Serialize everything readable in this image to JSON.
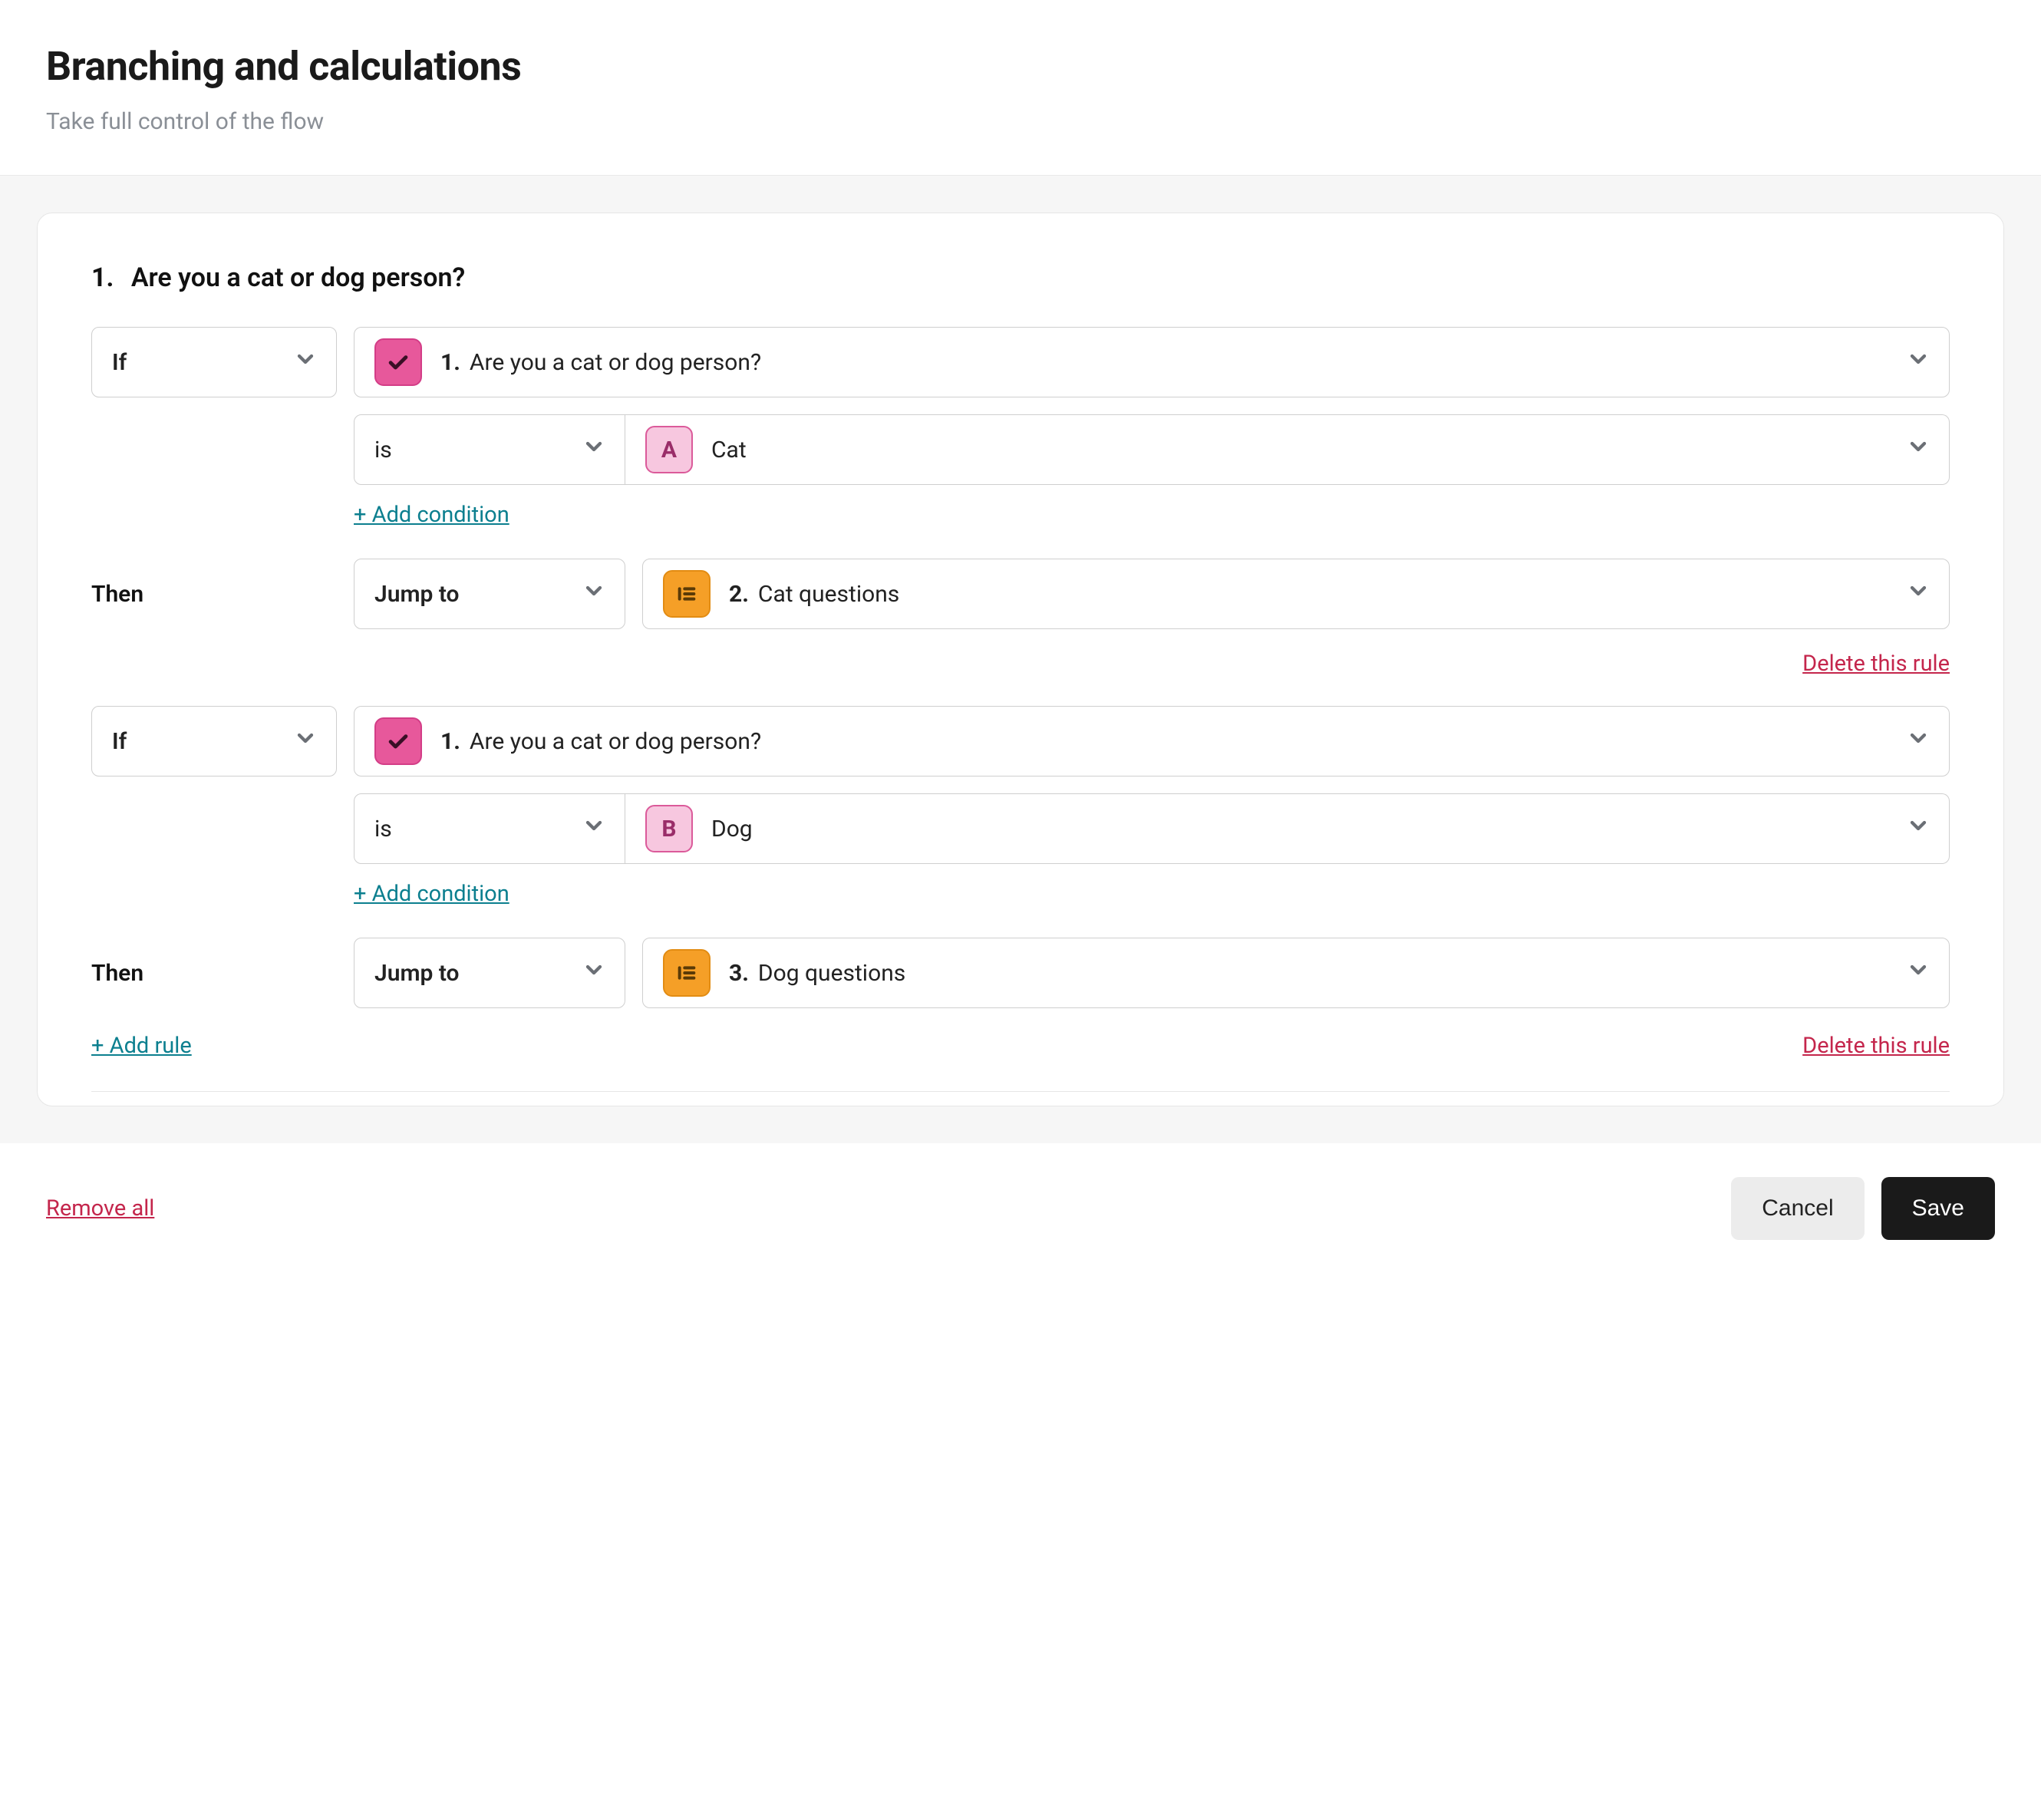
{
  "header": {
    "title": "Branching and calculations",
    "subtitle": "Take full control of the flow"
  },
  "panel": {
    "question_num": "1.",
    "question_text": "Are you a cat or dog person?"
  },
  "labels": {
    "if": "If",
    "then": "Then",
    "is": "is",
    "jump_to": "Jump to",
    "add_condition": "+ Add condition",
    "delete_rule": "Delete this rule",
    "add_rule": "+ Add rule"
  },
  "rules": [
    {
      "source_num": "1.",
      "source_text": "Are you a cat or dog person?",
      "answer_letter": "A",
      "answer_text": "Cat",
      "target_num": "2.",
      "target_text": "Cat questions"
    },
    {
      "source_num": "1.",
      "source_text": "Are you a cat or dog person?",
      "answer_letter": "B",
      "answer_text": "Dog",
      "target_num": "3.",
      "target_text": "Dog questions"
    }
  ],
  "footer": {
    "remove_all": "Remove all",
    "cancel": "Cancel",
    "save": "Save"
  }
}
